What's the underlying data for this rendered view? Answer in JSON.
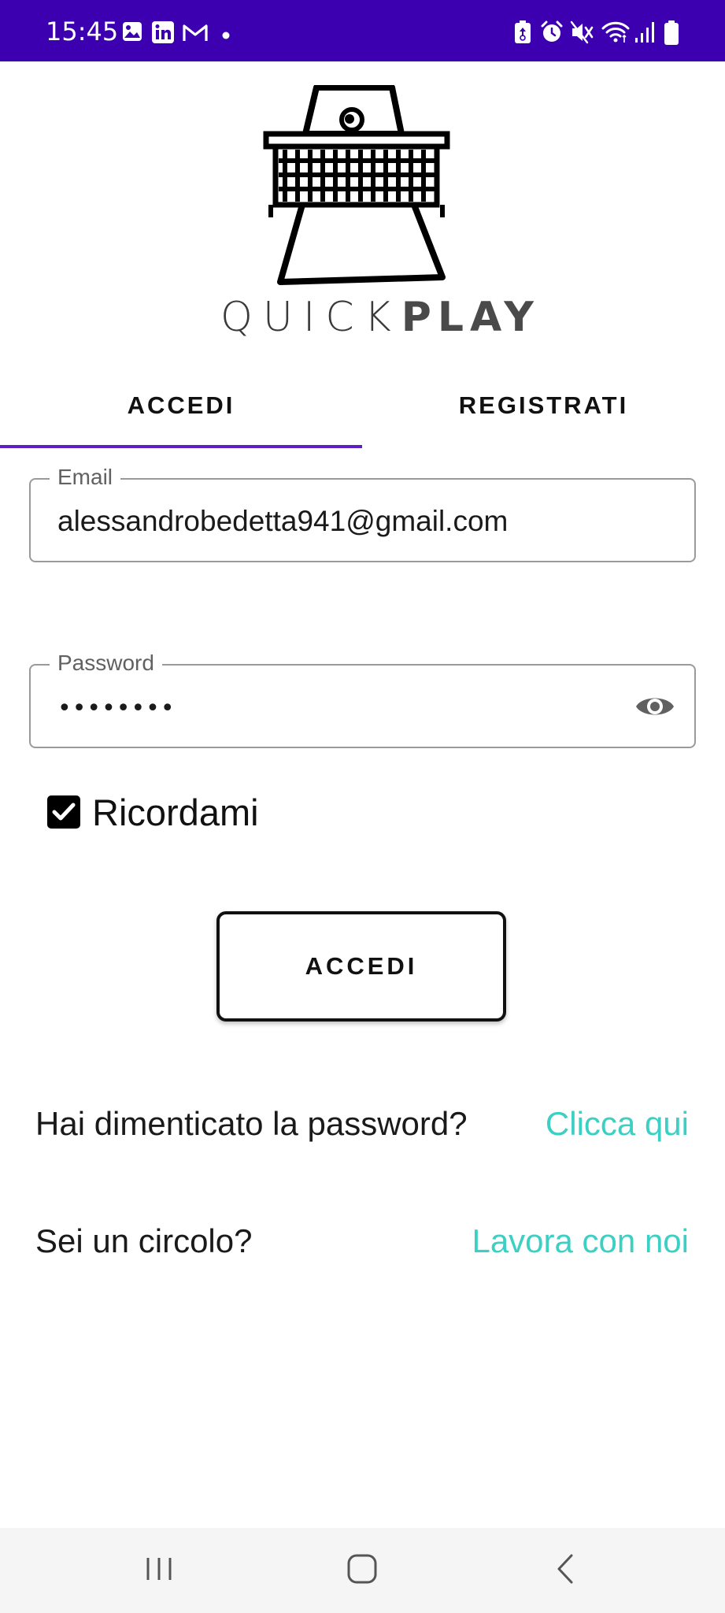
{
  "status_bar": {
    "time": "15:45",
    "background": "#3c00b0",
    "notification_icons": [
      "gallery-icon",
      "linkedin-icon",
      "gmail-icon",
      "dot-icon"
    ],
    "system_icons": [
      "battery-saver-icon",
      "alarm-icon",
      "mute-icon",
      "wifi-icon",
      "signal-icon",
      "battery-icon"
    ]
  },
  "logo": {
    "quick": "QUICK",
    "play": "PLAY"
  },
  "tabs": [
    {
      "label": "ACCEDI",
      "selected": true
    },
    {
      "label": "REGISTRATI",
      "selected": false
    }
  ],
  "accent_color": "#5d1fc6",
  "link_color": "#3ccfc4",
  "form": {
    "email": {
      "label": "Email",
      "value": "alessandrobedetta941@gmail.com"
    },
    "password": {
      "label": "Password",
      "masked_value": "••••••••",
      "toggle_icon": "eye-icon"
    },
    "remember": {
      "label": "Ricordami",
      "checked": true
    },
    "submit_label": "ACCEDI"
  },
  "links": {
    "forgot_text": "Hai dimenticato la password?",
    "forgot_link": "Clicca qui",
    "club_text": "Sei un circolo?",
    "club_link": "Lavora con noi"
  },
  "nav_bar": {
    "icons": [
      "recent-apps-icon",
      "home-icon",
      "back-icon"
    ]
  }
}
